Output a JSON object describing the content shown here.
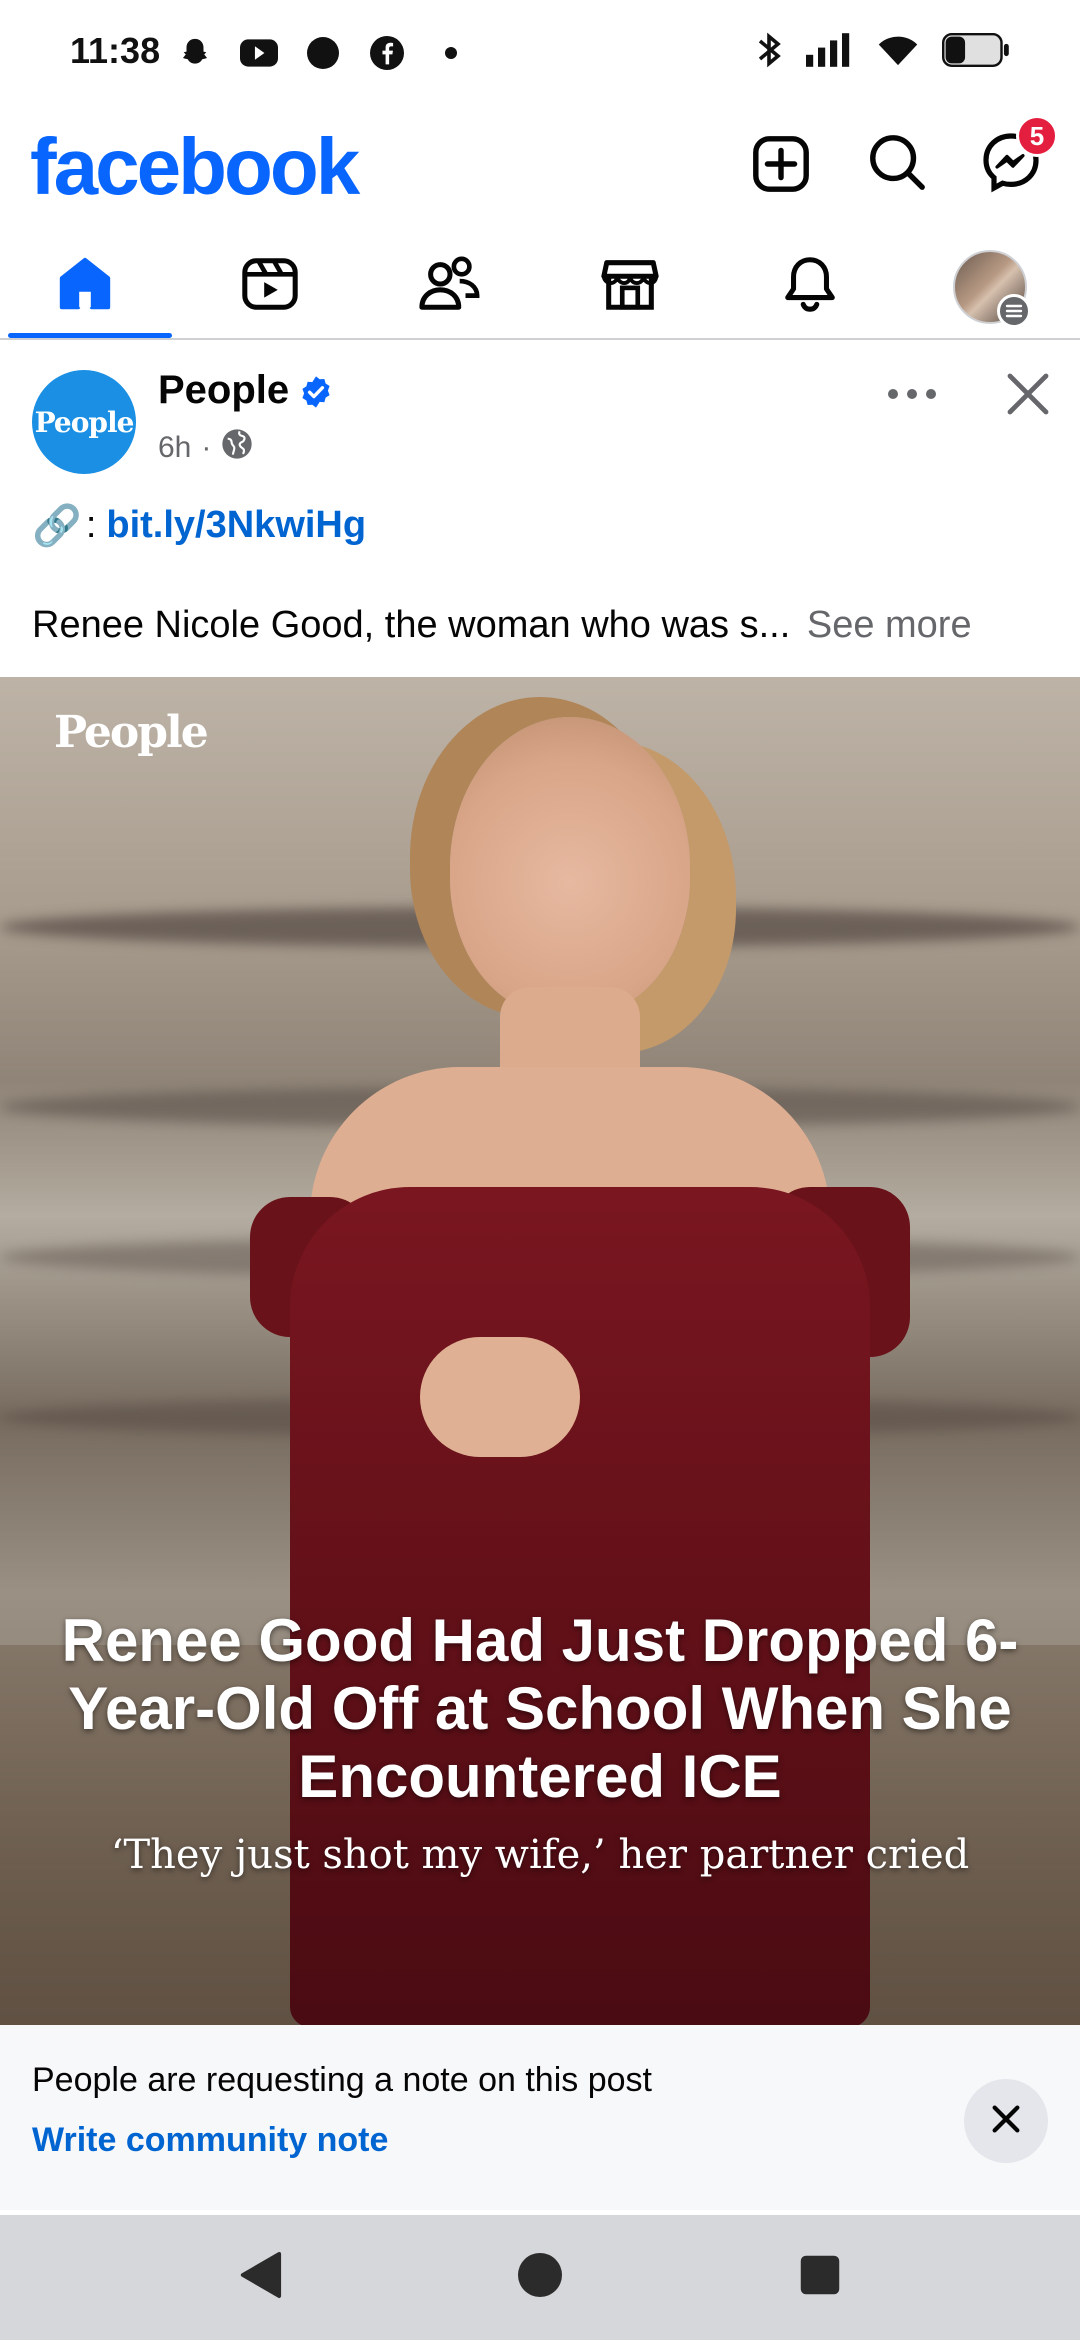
{
  "status_bar": {
    "time": "11:38",
    "left_icons": [
      "snapchat-icon",
      "youtube-icon",
      "circle-app-icon",
      "facebook-icon",
      "dot-icon"
    ],
    "right_icons": [
      "bluetooth-icon",
      "signal-icon",
      "wifi-icon",
      "battery-icon"
    ]
  },
  "header": {
    "logo": "facebook",
    "messenger_badge": "5",
    "brand_color": "#0866ff"
  },
  "nav": {
    "tabs": [
      {
        "name": "home",
        "active": true
      },
      {
        "name": "reels",
        "active": false
      },
      {
        "name": "friends",
        "active": false
      },
      {
        "name": "marketplace",
        "active": false
      },
      {
        "name": "notifications",
        "active": false
      },
      {
        "name": "profile-menu",
        "active": false
      }
    ]
  },
  "post": {
    "avatar_text": "People",
    "author": "People",
    "time": "6h",
    "separator": "·",
    "link_emoji": "🔗",
    "link_colon": ":",
    "link": "bit.ly/3NkwiHg",
    "text": "Renee Nicole Good, the woman who was s...",
    "see_more": "See more"
  },
  "photo": {
    "brand": "People",
    "headline": "Renee Good Had Just Dropped 6-Year-Old Off at School When She Encountered ICE",
    "subhead": "‘They just shot my wife,’ her partner cried"
  },
  "community_note": {
    "text": "People are requesting a note on this post",
    "link": "Write community note"
  }
}
